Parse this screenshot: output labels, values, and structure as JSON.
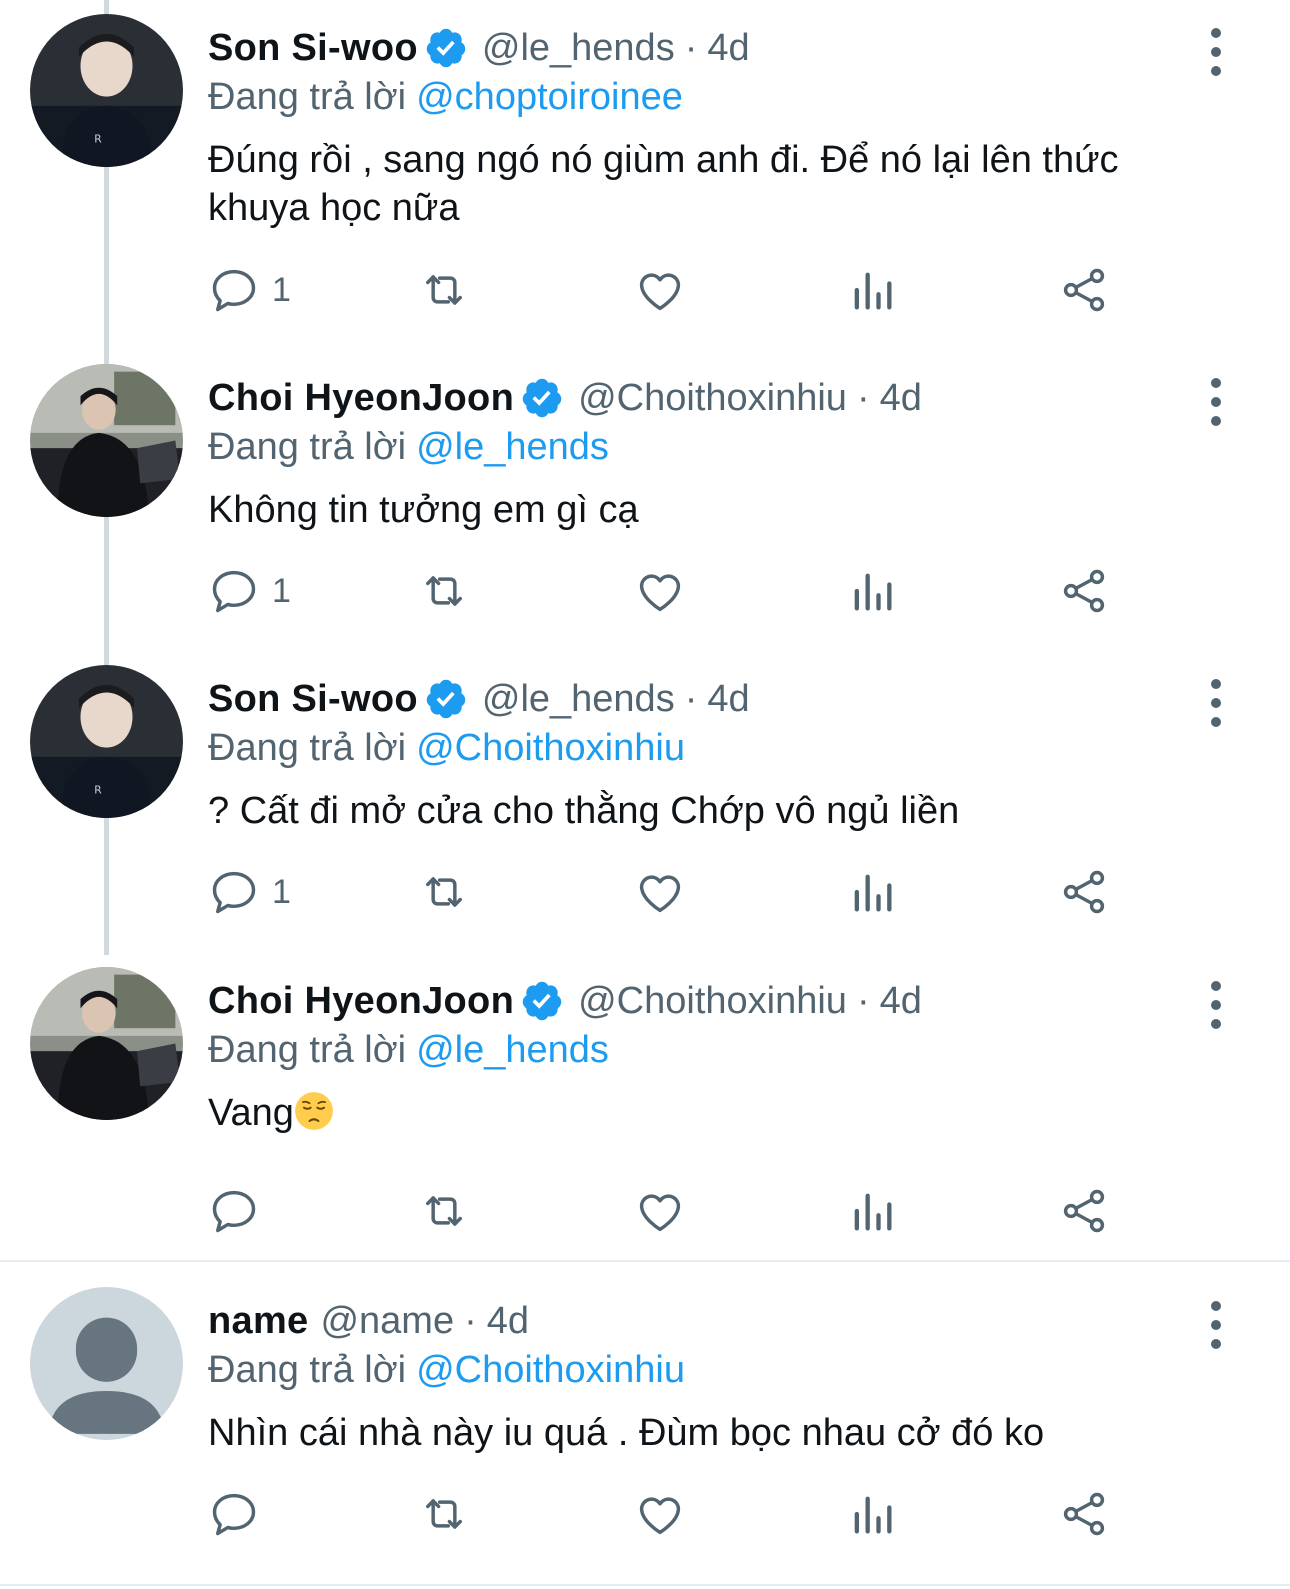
{
  "tweets": [
    {
      "display_name": "Son Si-woo",
      "verified": true,
      "handle": "@le_hends",
      "separator": "·",
      "time": "4d",
      "reply_prefix": "Đang trả lời",
      "reply_to": "@choptoiroinee",
      "text": "Đúng rồi , sang ngó nó giùm anh đi. Để nó lại lên thức khuya học nữa",
      "reply_count": "1",
      "avatar": "photo-son-si-woo"
    },
    {
      "display_name": "Choi HyeonJoon",
      "verified": true,
      "handle": "@Choithoxinhiu",
      "separator": "·",
      "time": "4d",
      "reply_prefix": "Đang trả lời",
      "reply_to": "@le_hends",
      "text": "Không tin tưởng em gì cạ",
      "reply_count": "1",
      "avatar": "photo-choi-hyeonjoon"
    },
    {
      "display_name": "Son Si-woo",
      "verified": true,
      "handle": "@le_hends",
      "separator": "·",
      "time": "4d",
      "reply_prefix": "Đang trả lời",
      "reply_to": "@Choithoxinhiu",
      "text": "? Cất đi mở cửa cho thằng Chớp vô ngủ liền",
      "reply_count": "1",
      "avatar": "photo-son-si-woo"
    },
    {
      "display_name": "Choi HyeonJoon",
      "verified": true,
      "handle": "@Choithoxinhiu",
      "separator": "·",
      "time": "4d",
      "reply_prefix": "Đang trả lời",
      "reply_to": "@le_hends",
      "text": "Vang",
      "emoji": "pensive-face-emoji",
      "reply_count": "",
      "avatar": "photo-choi-hyeonjoon"
    },
    {
      "display_name": "name",
      "verified": false,
      "handle": "@name",
      "separator": "·",
      "time": "4d",
      "reply_prefix": "Đang trả lời",
      "reply_to": "@Choithoxinhiu",
      "text": "Nhìn cái nhà này iu quá . Đùm bọc nhau cở đó ko",
      "reply_count": "",
      "avatar": "default-avatar"
    }
  ],
  "icons": {
    "reply": "reply-icon",
    "retweet": "retweet-icon",
    "like": "like-icon",
    "views": "views-icon",
    "share": "share-icon",
    "more": "more-icon",
    "verified": "verified-badge-icon"
  },
  "colors": {
    "text": "#0f1419",
    "secondary": "#536471",
    "link": "#1d9bf0",
    "verified": "#1d9bf0",
    "thread_line": "#cfd9de"
  }
}
